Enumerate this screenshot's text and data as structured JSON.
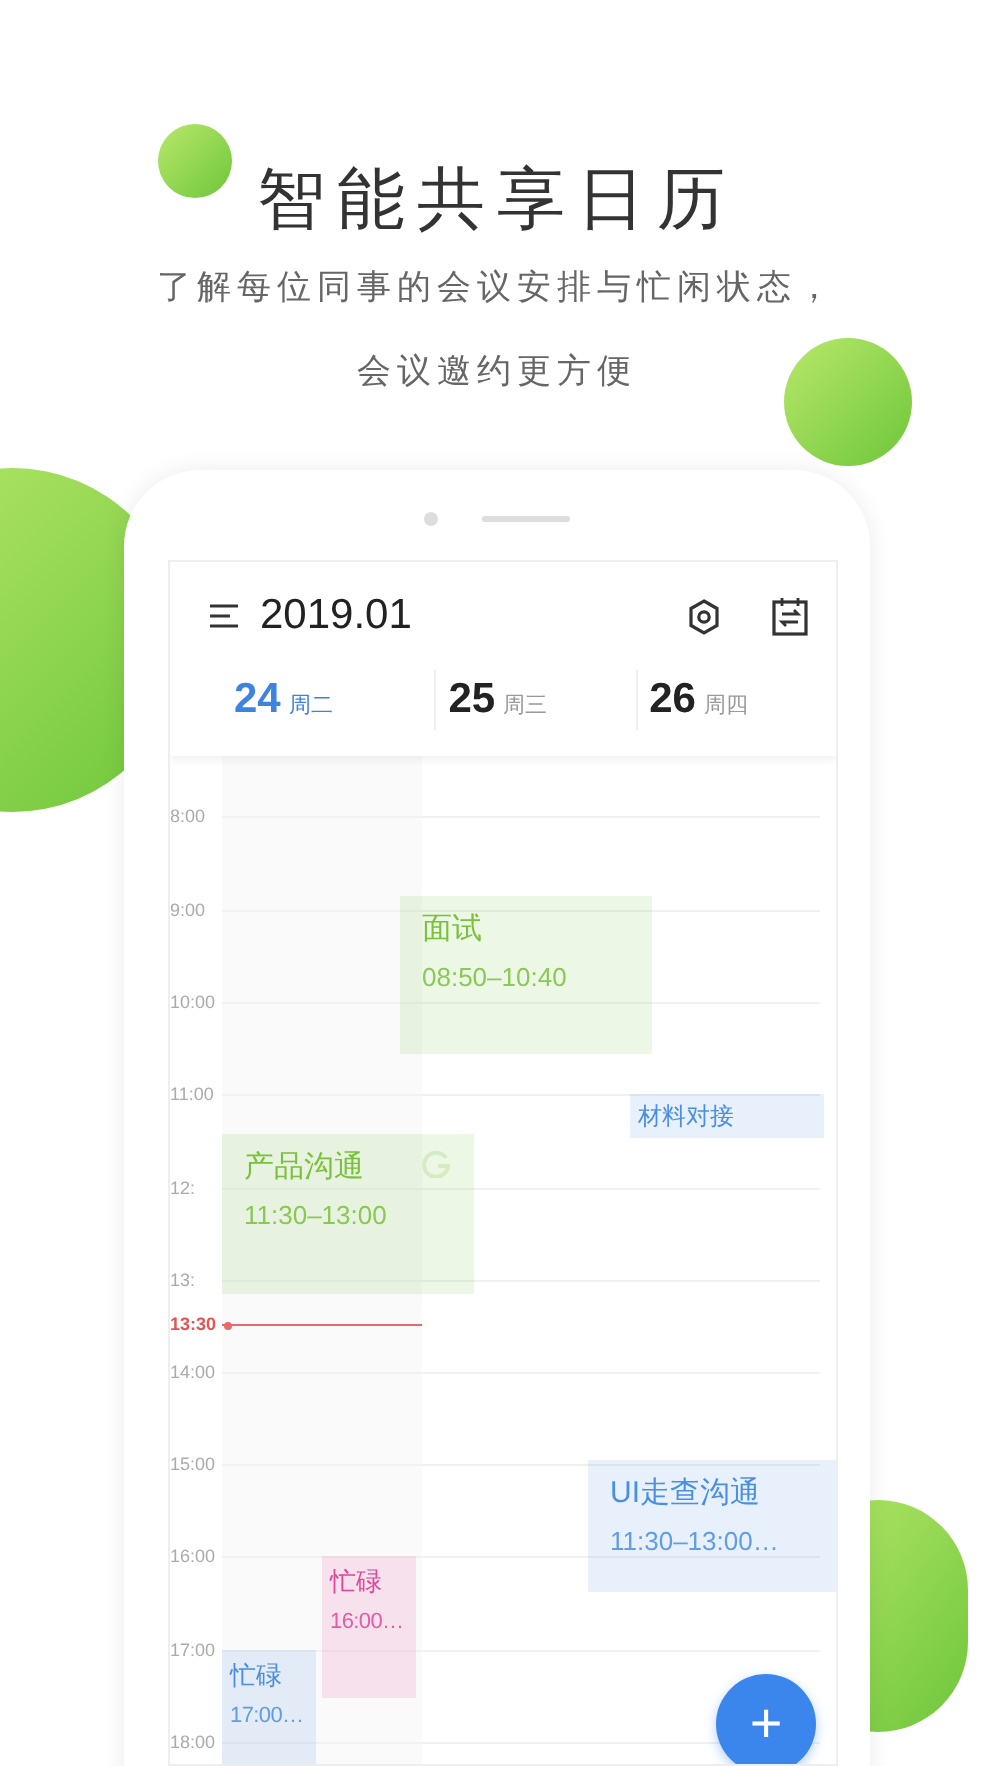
{
  "headline": "智能共享日历",
  "subtitle": [
    "了解每位同事的会议安排与忙闲状态，",
    "会议邀约更方便"
  ],
  "calendar": {
    "title": "2019.01",
    "days": [
      {
        "date": "24",
        "weekday": "周二",
        "selected": true
      },
      {
        "date": "25",
        "weekday": "周三",
        "selected": false
      },
      {
        "date": "26",
        "weekday": "周四",
        "selected": false
      }
    ],
    "time_labels": [
      {
        "text": "8:00",
        "kind": "hour"
      },
      {
        "text": "9:00",
        "kind": "hour"
      },
      {
        "text": "10:00",
        "kind": "hour"
      },
      {
        "text": "11:00",
        "kind": "hour"
      },
      {
        "text": "12:",
        "kind": "hour"
      },
      {
        "text": "13:",
        "kind": "hour"
      },
      {
        "text": "13:30",
        "kind": "now"
      },
      {
        "text": "14:00",
        "kind": "hour"
      },
      {
        "text": "15:00",
        "kind": "hour"
      },
      {
        "text": "16:00",
        "kind": "hour"
      },
      {
        "text": "17:00",
        "kind": "hour"
      },
      {
        "text": "18:00",
        "kind": "hour"
      }
    ],
    "events": [
      {
        "title": "面试",
        "time": "08:50–10:40",
        "color": "#79c13b"
      },
      {
        "title": "材料对接",
        "color": "#4a8fe0"
      },
      {
        "title": "产品沟通",
        "time": "11:30–13:00",
        "color": "#79c13b"
      },
      {
        "title": "UI走查沟通",
        "time": "11:30–13:00…",
        "color": "#4a8fe0"
      },
      {
        "title": "忙碌",
        "time": "16:00…",
        "color": "#e0479a"
      },
      {
        "title": "忙碌",
        "time": "17:00…",
        "color": "#4a8fe0"
      }
    ]
  },
  "add_button": {
    "label": "+"
  }
}
